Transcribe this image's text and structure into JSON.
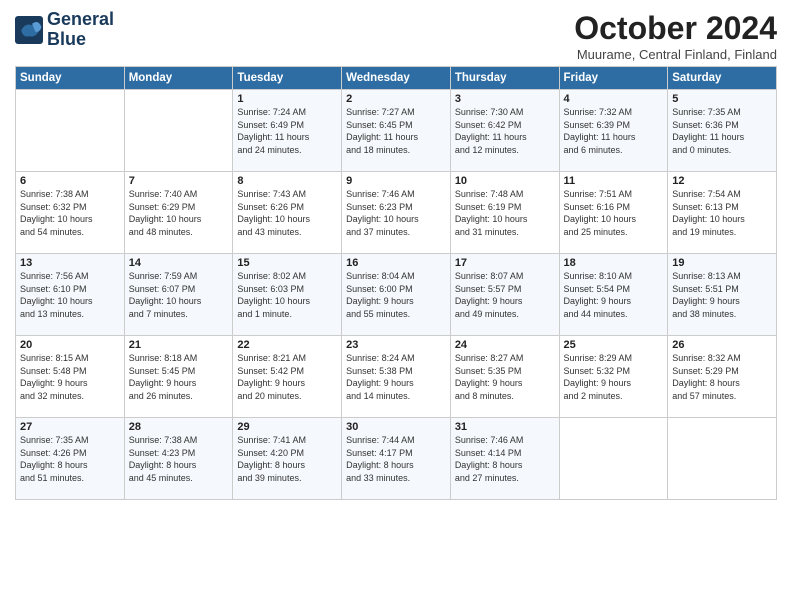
{
  "logo": {
    "line1": "General",
    "line2": "Blue"
  },
  "title": "October 2024",
  "location": "Muurame, Central Finland, Finland",
  "days_of_week": [
    "Sunday",
    "Monday",
    "Tuesday",
    "Wednesday",
    "Thursday",
    "Friday",
    "Saturday"
  ],
  "weeks": [
    [
      {
        "day": "",
        "info": ""
      },
      {
        "day": "",
        "info": ""
      },
      {
        "day": "1",
        "info": "Sunrise: 7:24 AM\nSunset: 6:49 PM\nDaylight: 11 hours\nand 24 minutes."
      },
      {
        "day": "2",
        "info": "Sunrise: 7:27 AM\nSunset: 6:45 PM\nDaylight: 11 hours\nand 18 minutes."
      },
      {
        "day": "3",
        "info": "Sunrise: 7:30 AM\nSunset: 6:42 PM\nDaylight: 11 hours\nand 12 minutes."
      },
      {
        "day": "4",
        "info": "Sunrise: 7:32 AM\nSunset: 6:39 PM\nDaylight: 11 hours\nand 6 minutes."
      },
      {
        "day": "5",
        "info": "Sunrise: 7:35 AM\nSunset: 6:36 PM\nDaylight: 11 hours\nand 0 minutes."
      }
    ],
    [
      {
        "day": "6",
        "info": "Sunrise: 7:38 AM\nSunset: 6:32 PM\nDaylight: 10 hours\nand 54 minutes."
      },
      {
        "day": "7",
        "info": "Sunrise: 7:40 AM\nSunset: 6:29 PM\nDaylight: 10 hours\nand 48 minutes."
      },
      {
        "day": "8",
        "info": "Sunrise: 7:43 AM\nSunset: 6:26 PM\nDaylight: 10 hours\nand 43 minutes."
      },
      {
        "day": "9",
        "info": "Sunrise: 7:46 AM\nSunset: 6:23 PM\nDaylight: 10 hours\nand 37 minutes."
      },
      {
        "day": "10",
        "info": "Sunrise: 7:48 AM\nSunset: 6:19 PM\nDaylight: 10 hours\nand 31 minutes."
      },
      {
        "day": "11",
        "info": "Sunrise: 7:51 AM\nSunset: 6:16 PM\nDaylight: 10 hours\nand 25 minutes."
      },
      {
        "day": "12",
        "info": "Sunrise: 7:54 AM\nSunset: 6:13 PM\nDaylight: 10 hours\nand 19 minutes."
      }
    ],
    [
      {
        "day": "13",
        "info": "Sunrise: 7:56 AM\nSunset: 6:10 PM\nDaylight: 10 hours\nand 13 minutes."
      },
      {
        "day": "14",
        "info": "Sunrise: 7:59 AM\nSunset: 6:07 PM\nDaylight: 10 hours\nand 7 minutes."
      },
      {
        "day": "15",
        "info": "Sunrise: 8:02 AM\nSunset: 6:03 PM\nDaylight: 10 hours\nand 1 minute."
      },
      {
        "day": "16",
        "info": "Sunrise: 8:04 AM\nSunset: 6:00 PM\nDaylight: 9 hours\nand 55 minutes."
      },
      {
        "day": "17",
        "info": "Sunrise: 8:07 AM\nSunset: 5:57 PM\nDaylight: 9 hours\nand 49 minutes."
      },
      {
        "day": "18",
        "info": "Sunrise: 8:10 AM\nSunset: 5:54 PM\nDaylight: 9 hours\nand 44 minutes."
      },
      {
        "day": "19",
        "info": "Sunrise: 8:13 AM\nSunset: 5:51 PM\nDaylight: 9 hours\nand 38 minutes."
      }
    ],
    [
      {
        "day": "20",
        "info": "Sunrise: 8:15 AM\nSunset: 5:48 PM\nDaylight: 9 hours\nand 32 minutes."
      },
      {
        "day": "21",
        "info": "Sunrise: 8:18 AM\nSunset: 5:45 PM\nDaylight: 9 hours\nand 26 minutes."
      },
      {
        "day": "22",
        "info": "Sunrise: 8:21 AM\nSunset: 5:42 PM\nDaylight: 9 hours\nand 20 minutes."
      },
      {
        "day": "23",
        "info": "Sunrise: 8:24 AM\nSunset: 5:38 PM\nDaylight: 9 hours\nand 14 minutes."
      },
      {
        "day": "24",
        "info": "Sunrise: 8:27 AM\nSunset: 5:35 PM\nDaylight: 9 hours\nand 8 minutes."
      },
      {
        "day": "25",
        "info": "Sunrise: 8:29 AM\nSunset: 5:32 PM\nDaylight: 9 hours\nand 2 minutes."
      },
      {
        "day": "26",
        "info": "Sunrise: 8:32 AM\nSunset: 5:29 PM\nDaylight: 8 hours\nand 57 minutes."
      }
    ],
    [
      {
        "day": "27",
        "info": "Sunrise: 7:35 AM\nSunset: 4:26 PM\nDaylight: 8 hours\nand 51 minutes."
      },
      {
        "day": "28",
        "info": "Sunrise: 7:38 AM\nSunset: 4:23 PM\nDaylight: 8 hours\nand 45 minutes."
      },
      {
        "day": "29",
        "info": "Sunrise: 7:41 AM\nSunset: 4:20 PM\nDaylight: 8 hours\nand 39 minutes."
      },
      {
        "day": "30",
        "info": "Sunrise: 7:44 AM\nSunset: 4:17 PM\nDaylight: 8 hours\nand 33 minutes."
      },
      {
        "day": "31",
        "info": "Sunrise: 7:46 AM\nSunset: 4:14 PM\nDaylight: 8 hours\nand 27 minutes."
      },
      {
        "day": "",
        "info": ""
      },
      {
        "day": "",
        "info": ""
      }
    ]
  ]
}
